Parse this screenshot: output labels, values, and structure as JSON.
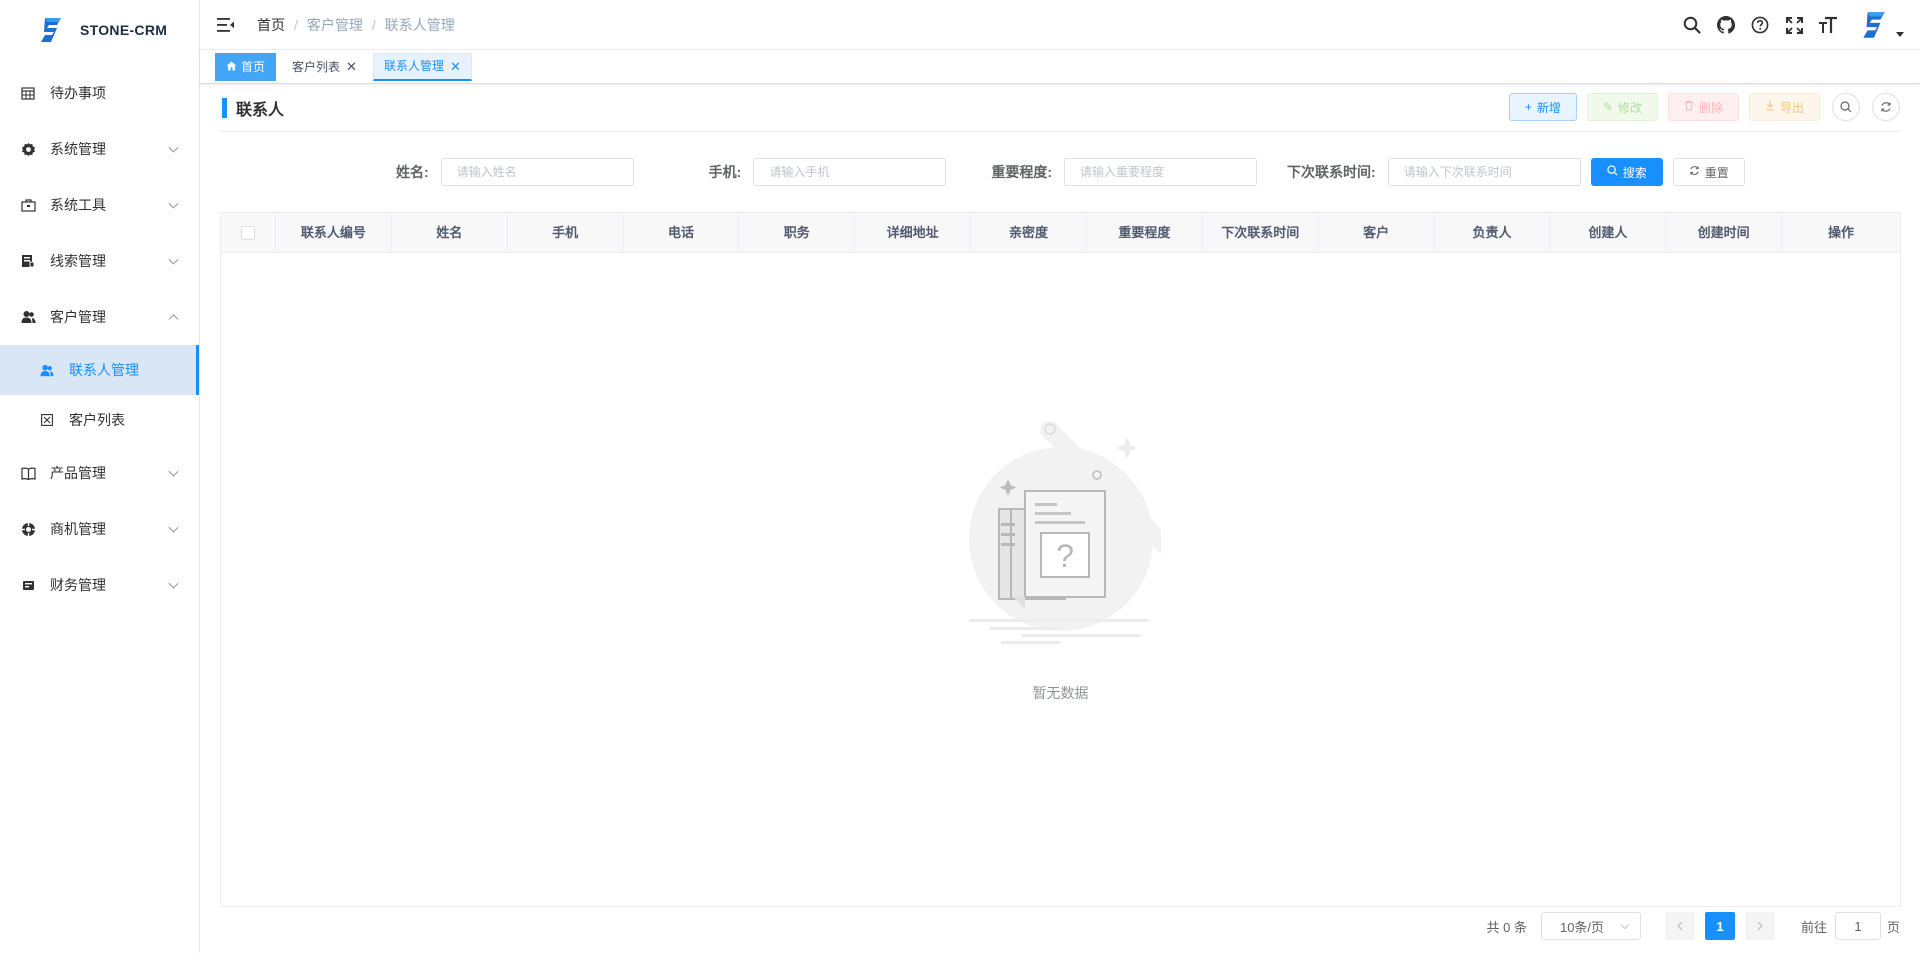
{
  "app": {
    "name": "STONE-CRM",
    "brand_color": "#1890ff"
  },
  "sidebar": {
    "items": [
      {
        "label": "待办事项",
        "icon": "calendar-icon",
        "expandable": false
      },
      {
        "label": "系统管理",
        "icon": "gear-icon",
        "expandable": true
      },
      {
        "label": "系统工具",
        "icon": "toolbox-icon",
        "expandable": true
      },
      {
        "label": "线索管理",
        "icon": "clue-icon",
        "expandable": true
      },
      {
        "label": "客户管理",
        "icon": "users-icon",
        "expandable": true,
        "expanded": true,
        "children": [
          {
            "label": "联系人管理",
            "icon": "contact-icon",
            "active": true
          },
          {
            "label": "客户列表",
            "icon": "list-icon",
            "active": false
          }
        ]
      },
      {
        "label": "产品管理",
        "icon": "book-icon",
        "expandable": true
      },
      {
        "label": "商机管理",
        "icon": "opportunity-icon",
        "expandable": true
      },
      {
        "label": "财务管理",
        "icon": "finance-icon",
        "expandable": true
      }
    ]
  },
  "header": {
    "breadcrumb": [
      "首页",
      "客户管理",
      "联系人管理"
    ],
    "icons": [
      "search-icon",
      "github-icon",
      "help-icon",
      "fullscreen-icon",
      "font-size-icon"
    ]
  },
  "tags": [
    {
      "label": "首页",
      "type": "home"
    },
    {
      "label": "客户列表",
      "type": "normal",
      "closable": true
    },
    {
      "label": "联系人管理",
      "type": "current",
      "closable": true
    }
  ],
  "page": {
    "title": "联系人",
    "actions": {
      "add": "新增",
      "edit": "修改",
      "delete": "删除",
      "export": "导出"
    }
  },
  "search": {
    "fields": [
      {
        "label": "姓名:",
        "placeholder": "请输入姓名"
      },
      {
        "label": "手机:",
        "placeholder": "请输入手机"
      },
      {
        "label": "重要程度:",
        "placeholder": "请输入重要程度"
      },
      {
        "label": "下次联系时间:",
        "placeholder": "请输入下次联系时间"
      }
    ],
    "search_label": "搜索",
    "reset_label": "重置"
  },
  "table": {
    "columns": [
      "联系人编号",
      "姓名",
      "手机",
      "电话",
      "职务",
      "详细地址",
      "亲密度",
      "重要程度",
      "下次联系时间",
      "客户",
      "负责人",
      "创建人",
      "创建时间",
      "操作"
    ],
    "rows": [],
    "empty_text": "暂无数据"
  },
  "pagination": {
    "total_text": "共 0 条",
    "page_size": "10条/页",
    "current_page": "1",
    "goto_label": "前往",
    "goto_value": "1",
    "page_suffix": "页"
  }
}
